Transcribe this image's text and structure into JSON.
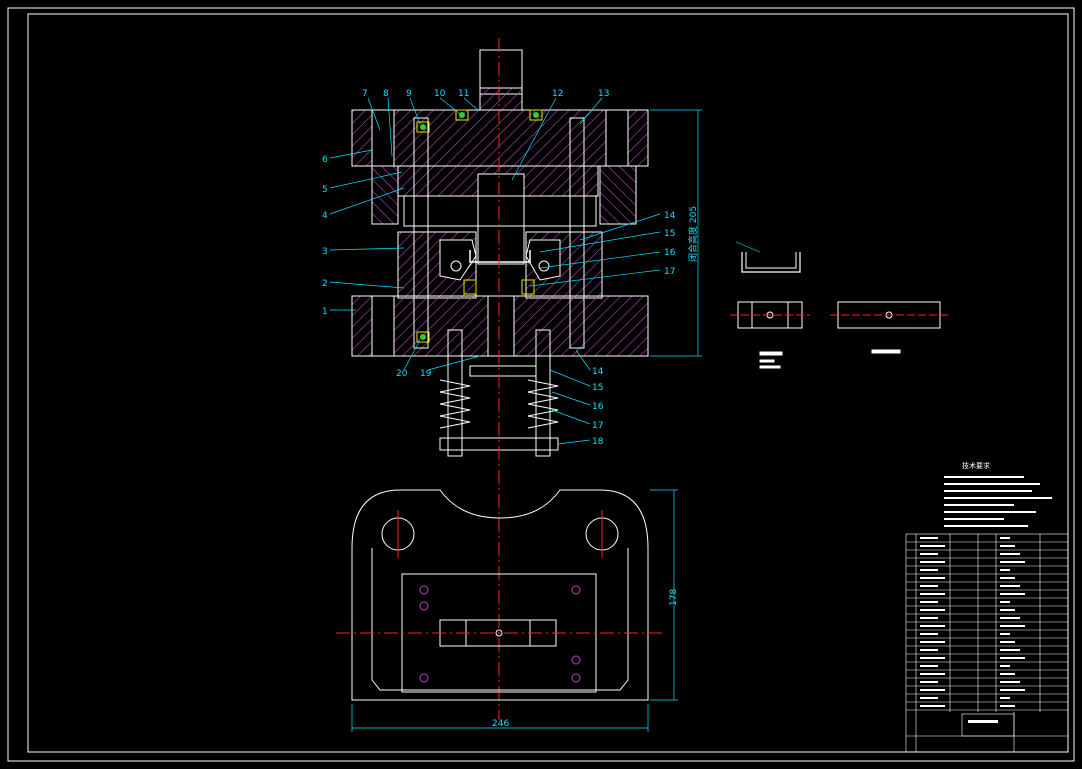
{
  "drawing": {
    "part_labels_left": [
      "7",
      "8",
      "9",
      "10",
      "11",
      "12",
      "13",
      "6",
      "5",
      "4",
      "3",
      "2",
      "1",
      "20",
      "19"
    ],
    "part_labels_right": [
      "14",
      "15",
      "16",
      "17",
      "14",
      "15",
      "16",
      "17",
      "18"
    ],
    "dimension_height": "闭合高度 205",
    "dimension_width": "246",
    "dimension_depth": "178",
    "notes_title": "技术要求"
  },
  "colors": {
    "background": "#000000",
    "outline": "#ffffff",
    "hatch": "#c040c0",
    "centerline": "#ff2020",
    "dimension": "#00e5ff",
    "yellow": "#e8e800",
    "green": "#30d030"
  }
}
